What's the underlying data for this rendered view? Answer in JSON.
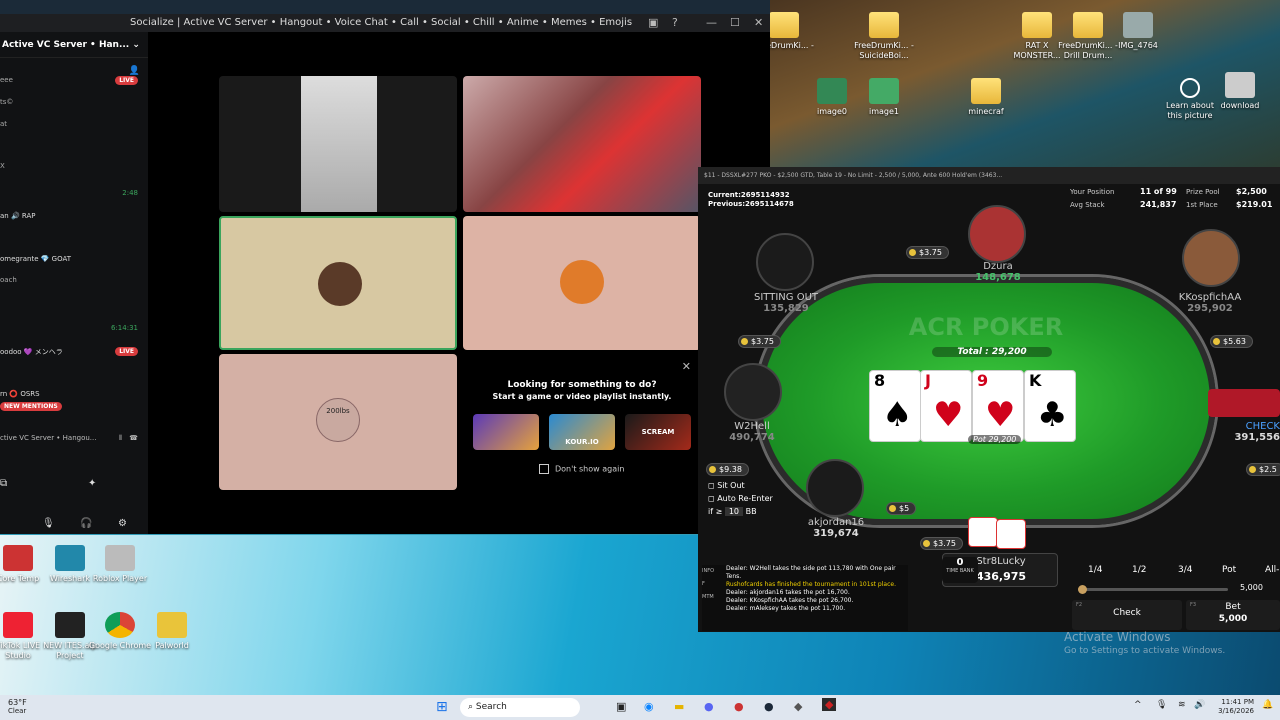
{
  "discord": {
    "window_title": "Socialize | Active VC Server • Hangout • Voice Chat • Call • Social • Chill • Anime • Memes • Emojis",
    "server_name": "Active VC Server • Han...",
    "channels": [
      {
        "text": "eee",
        "badge": "LIVE"
      },
      {
        "text": "ts©"
      },
      {
        "text": "at"
      },
      {
        "text": "X"
      },
      {
        "text": "",
        "time": "2:48"
      },
      {
        "text": "an 🔊 RAP"
      },
      {
        "text": "omegrante  💎 GOAT"
      },
      {
        "text": "oach"
      },
      {
        "text": "",
        "time": "6:14:31"
      },
      {
        "text": "oodoo 💜 メンヘラ",
        "badge": "LIVE"
      },
      {
        "text": "rn  ⭕ OSRS"
      }
    ],
    "new_mentions": "NEW MENTIONS",
    "voice_server": "ctive VC Server • Hangou...",
    "activity_close": "✕",
    "activity_title": "Looking for something to do?",
    "activity_sub": "Start a game or video playlist instantly.",
    "dont_show": "Don't show again",
    "activity_tiles": [
      "",
      "KOUR.IO",
      "SCREAM"
    ],
    "tile_text": "200lbs"
  },
  "desktop_icons": [
    {
      "label": "FreeDrumKi... -",
      "kind": "folder"
    },
    {
      "label": "FreeDrumKi... - SuicideBoi...",
      "kind": "folder"
    },
    {
      "label": "RAT X MONSTER...",
      "kind": "folder"
    },
    {
      "label": "FreeDrumKi... - Drill Drum...",
      "kind": "folder"
    },
    {
      "label": "IMG_4764",
      "kind": "file"
    },
    {
      "label": "image0",
      "kind": "image"
    },
    {
      "label": "image1",
      "kind": "image"
    },
    {
      "label": "minecraf",
      "kind": "folder"
    },
    {
      "label": "Learn about this picture",
      "kind": "info"
    },
    {
      "label": "download",
      "kind": "image"
    }
  ],
  "desktop_bottom_icons": [
    {
      "label": "Core Temp"
    },
    {
      "label": "Wireshark"
    },
    {
      "label": "Roblox Player"
    },
    {
      "label": "TikTok LIVE Studio"
    },
    {
      "label": "NEW ITES.alp Project"
    },
    {
      "label": "Google Chrome"
    },
    {
      "label": "Palworld"
    }
  ],
  "poker": {
    "title": "$11 - DSSXL#277 PKO - $2,500 GTD, Table 19 - No Limit - 2,500 / 5,000, Ante 600 Hold'em (3463...",
    "current": "Current:2695114932",
    "previous": "Previous:2695114678",
    "your_position_label": "Your Position",
    "your_position": "11 of 99",
    "avg_stack_label": "Avg Stack",
    "avg_stack": "241,837",
    "prize_pool_label": "Prize Pool",
    "prize_pool": "$2,500",
    "first_place_label": "1st Place",
    "first_place": "$219.01",
    "total": "Total : 29,200",
    "pot": "Pot 29,200",
    "logo": "ACR POKER",
    "board": [
      {
        "rank": "8",
        "suit": "♠",
        "color": "#000"
      },
      {
        "rank": "J",
        "suit": "♥",
        "color": "#d0021b"
      },
      {
        "rank": "9",
        "suit": "♥",
        "color": "#d0021b"
      },
      {
        "rank": "K",
        "suit": "♣",
        "color": "#000"
      }
    ],
    "seats": [
      {
        "name": "Dzura",
        "stack": "148,678",
        "bet": "$3.75"
      },
      {
        "name": "SITTING OUT",
        "stack": "135,829",
        "bet": "$3.75"
      },
      {
        "name": "KKospfichAA",
        "stack": "295,902",
        "bet": "$5.63"
      },
      {
        "name": "W2Hell",
        "stack": "490,774",
        "bet": "$9.38"
      },
      {
        "name": "CHECK",
        "stack": "391,556",
        "bet": "$2.5"
      },
      {
        "name": "akjordan16",
        "stack": "319,674",
        "bet": "$5"
      },
      {
        "name": "Str8Lucky",
        "stack": "436,975",
        "bet": "$3.75"
      }
    ],
    "sit_out": "Sit Out",
    "auto_reenter": "Auto Re-Enter",
    "if_label": "if ≥",
    "if_value": "10",
    "bb": "BB",
    "time_bank": "TIME BANK",
    "time_bank_value": "0",
    "chat": [
      {
        "t": "Dealer: W2Hell takes the side pot 113,780 with One pair Tens.",
        "c": "#fff"
      },
      {
        "t": "Rushofcards has finished the tournament in 101st place.",
        "c": "#f0d000"
      },
      {
        "t": "Dealer: akjordan16 takes the pot 16,700.",
        "c": "#fff"
      },
      {
        "t": "Dealer: KKospfichAA takes the pot 26,700.",
        "c": "#fff"
      },
      {
        "t": "Dealer: mAleksey takes the pot 11,700.",
        "c": "#fff"
      }
    ],
    "chat_tabs": [
      "INFO",
      "F",
      "MTM"
    ],
    "sizes": [
      "1/4",
      "1/2",
      "3/4",
      "Pot",
      "All-"
    ],
    "bet_amount": "5,000",
    "check_label": "Check",
    "bet_label": "Bet",
    "bet_value": "5,000",
    "f2": "F2",
    "f3": "F3"
  },
  "watermark_line1": "Activate Windows",
  "watermark_line2": "Go to Settings to activate Windows.",
  "taskbar": {
    "weather_temp": "63°F",
    "weather_desc": "Clear",
    "search": "Search",
    "time": "11:41 PM",
    "date": "3/16/2026"
  }
}
